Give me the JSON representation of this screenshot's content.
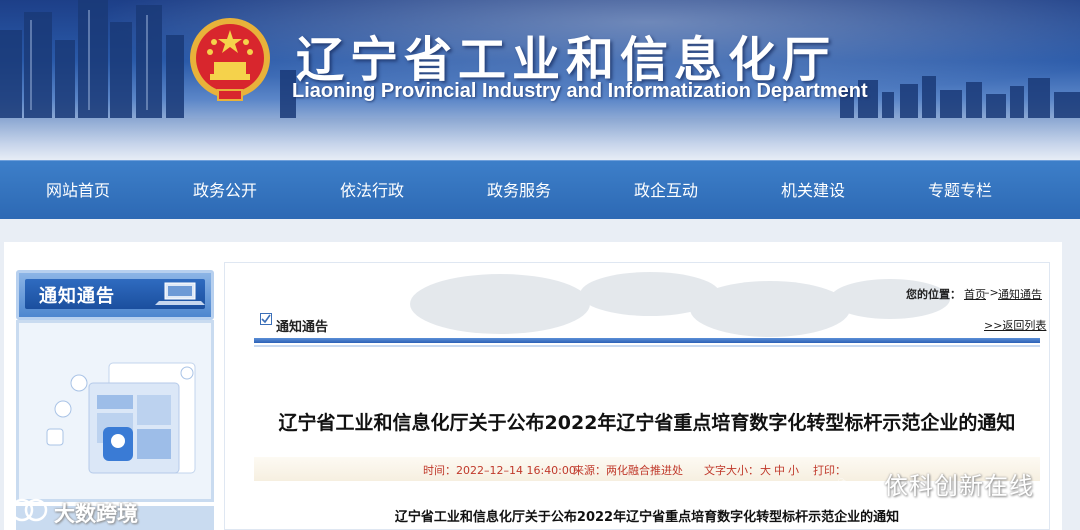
{
  "header": {
    "title_cn": "辽宁省工业和信息化厅",
    "title_en": "Liaoning Provincial Industry and Informatization Department"
  },
  "nav": {
    "items": [
      {
        "label": "网站首页"
      },
      {
        "label": "政务公开"
      },
      {
        "label": "依法行政"
      },
      {
        "label": "政务服务"
      },
      {
        "label": "政企互动"
      },
      {
        "label": "机关建设"
      },
      {
        "label": "专题专栏"
      }
    ]
  },
  "sidebar": {
    "heading": "通知通告"
  },
  "breadcrumb": {
    "label": "您的位置：",
    "home": "首页",
    "separator": "–>",
    "current": "通知通告"
  },
  "section": {
    "title": "通知通告",
    "back_link": ">>返回列表"
  },
  "article": {
    "title": "辽宁省工业和信息化厅关于公布2022年辽宁省重点培育数字化转型标杆示范企业的通知",
    "time": "时间：2022–12–14 16:40:00",
    "source": "来源：两化融合推进处",
    "font_size_label": "文字大小：",
    "font_sizes": [
      "大",
      "中",
      "小"
    ],
    "print_label": "打印：",
    "body_title": "辽宁省工业和信息化厅关于公布2022年辽宁省重点培育数字化转型标杆示范企业的通知"
  },
  "watermarks": {
    "right": "依科创新在线",
    "left": "大数跨境"
  },
  "colors": {
    "nav_bg": "#2d69b4",
    "accent_red": "#c0392b",
    "rule_blue": "#2d62b7"
  }
}
